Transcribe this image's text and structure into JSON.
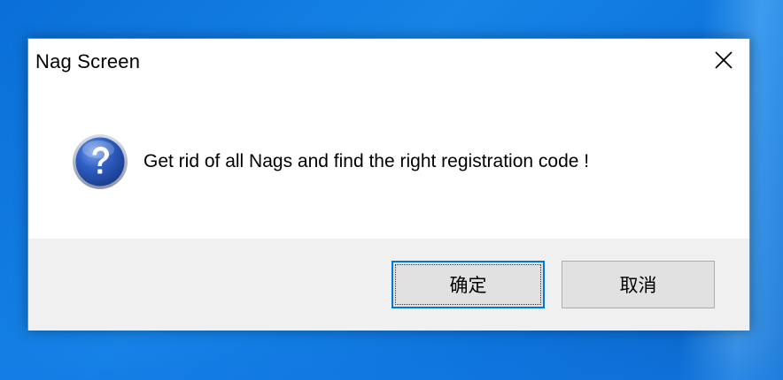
{
  "dialog": {
    "title": "Nag Screen",
    "message": "Get rid of all Nags and find the right registration code !",
    "icon": "question-icon",
    "close_icon": "close-icon"
  },
  "buttons": {
    "ok_label": "确定",
    "cancel_label": "取消"
  },
  "colors": {
    "desktop": "#1683e6",
    "dialog_bg": "#ffffff",
    "footer_bg": "#f0f0f0",
    "button_bg": "#e1e1e1",
    "focus_border": "#0078d7",
    "icon_blue": "#1e4aa8"
  }
}
